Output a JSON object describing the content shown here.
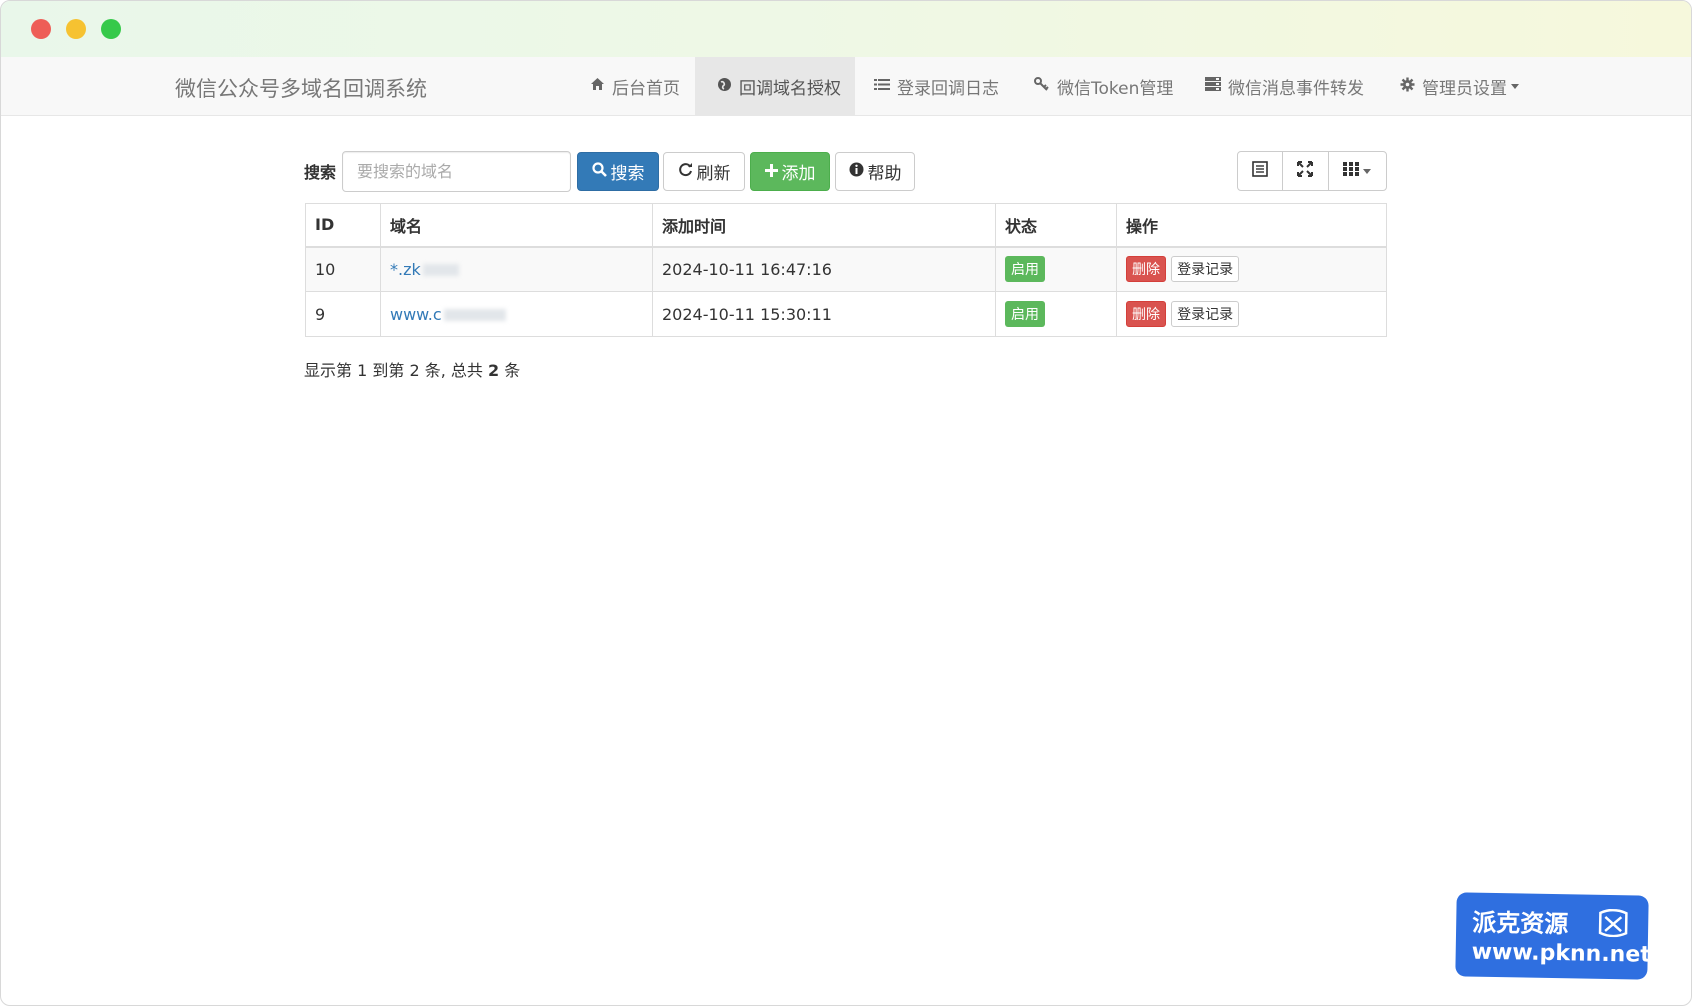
{
  "navbar": {
    "brand": "微信公众号多域名回调系统",
    "items": [
      {
        "label": "后台首页",
        "icon": "home-icon",
        "active": false
      },
      {
        "label": "回调域名授权",
        "icon": "globe-icon",
        "active": true
      },
      {
        "label": "登录回调日志",
        "icon": "list-icon",
        "active": false
      },
      {
        "label": "微信Token管理",
        "icon": "key-icon",
        "active": false
      },
      {
        "label": "微信消息事件转发",
        "icon": "server-icon",
        "active": false
      },
      {
        "label": "管理员设置",
        "icon": "gear-icon",
        "active": false,
        "dropdown": true
      }
    ]
  },
  "toolbar": {
    "search_label": "搜索",
    "search_placeholder": "要搜索的域名",
    "search_button": "搜索",
    "refresh_button": "刷新",
    "add_button": "添加",
    "help_button": "帮助"
  },
  "table": {
    "columns": [
      "ID",
      "域名",
      "添加时间",
      "状态",
      "操作"
    ],
    "rows": [
      {
        "id": "10",
        "domain": "*.zk",
        "time": "2024-10-11 16:47:16",
        "status": "启用",
        "delete": "删除",
        "log": "登录记录"
      },
      {
        "id": "9",
        "domain": "www.c",
        "time": "2024-10-11 15:30:11",
        "status": "启用",
        "delete": "删除",
        "log": "登录记录"
      }
    ]
  },
  "pagination": {
    "prefix": "显示第 1 到第 2 条, 总共 ",
    "total": "2",
    "suffix": " 条"
  },
  "watermark": {
    "line1": "派克资源",
    "line2": "www.pknn.net"
  },
  "colors": {
    "primary": "#337ab7",
    "success": "#5cb85c",
    "danger": "#d9534f",
    "watermark": "#2f6fe0"
  }
}
